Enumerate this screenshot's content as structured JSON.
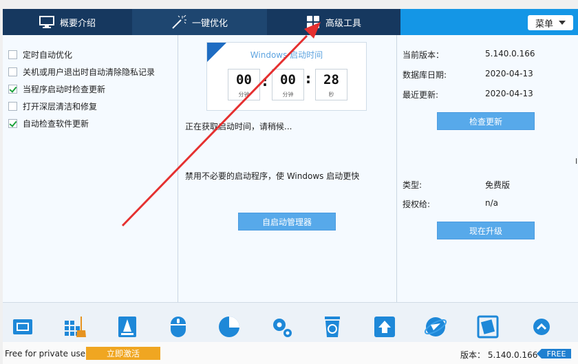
{
  "tabs": [
    {
      "label": "概要介绍",
      "icon": "monitor-icon"
    },
    {
      "label": "一键优化",
      "icon": "magic-wand-icon"
    },
    {
      "label": "高级工具",
      "icon": "grid-icon"
    }
  ],
  "menu": {
    "label": "菜单"
  },
  "options": [
    {
      "label": "定时自动优化",
      "checked": false
    },
    {
      "label": "关机或用户退出时自动清除隐私记录",
      "checked": false
    },
    {
      "label": "当程序启动时检查更新",
      "checked": true
    },
    {
      "label": "打开深层清洁和修复",
      "checked": false
    },
    {
      "label": "自动检查软件更新",
      "checked": true
    }
  ],
  "boot": {
    "title": "Windows 启动时间",
    "hours": "00",
    "hours_unit": "分钟",
    "minutes": "00",
    "minutes_unit": "分钟",
    "seconds": "28",
    "seconds_unit": "秒",
    "sep": ":",
    "status": "正在获取启动时间，请稍候...",
    "hint": "禁用不必要的启动程序，使 Windows 启动更快",
    "manager_button": "自启动管理器"
  },
  "info": {
    "version_label": "当前版本：",
    "version_value": "5.140.0.166",
    "db_label": "数据库日期:",
    "db_value": "2020-04-13",
    "update_label": "最近更新:",
    "update_value": "2020-04-13",
    "check_button": "检查更新",
    "type_label": "类型:",
    "type_value": "免费版",
    "license_label": "授权给:",
    "license_value": "n/a",
    "upgrade_button": "现在升级"
  },
  "bottom_icons": [
    "disk-icon",
    "registry-cleaner-icon",
    "disk-cleaner-icon",
    "mouse-icon",
    "pie-chart-icon",
    "gears-icon",
    "recycle-bin-icon",
    "upload-icon",
    "internet-icon",
    "restore-icon",
    "scroll-up-icon"
  ],
  "status": {
    "free_text": "Free for private use",
    "activate": "立即激活",
    "version": "版本： 5.140.0.166",
    "badge": "FREE"
  },
  "colors": {
    "accent": "#1496e6",
    "tab_dark": "#16385f",
    "button": "#57a9ea",
    "activate": "#f0a621",
    "annotation_arrow": "#e53030"
  }
}
